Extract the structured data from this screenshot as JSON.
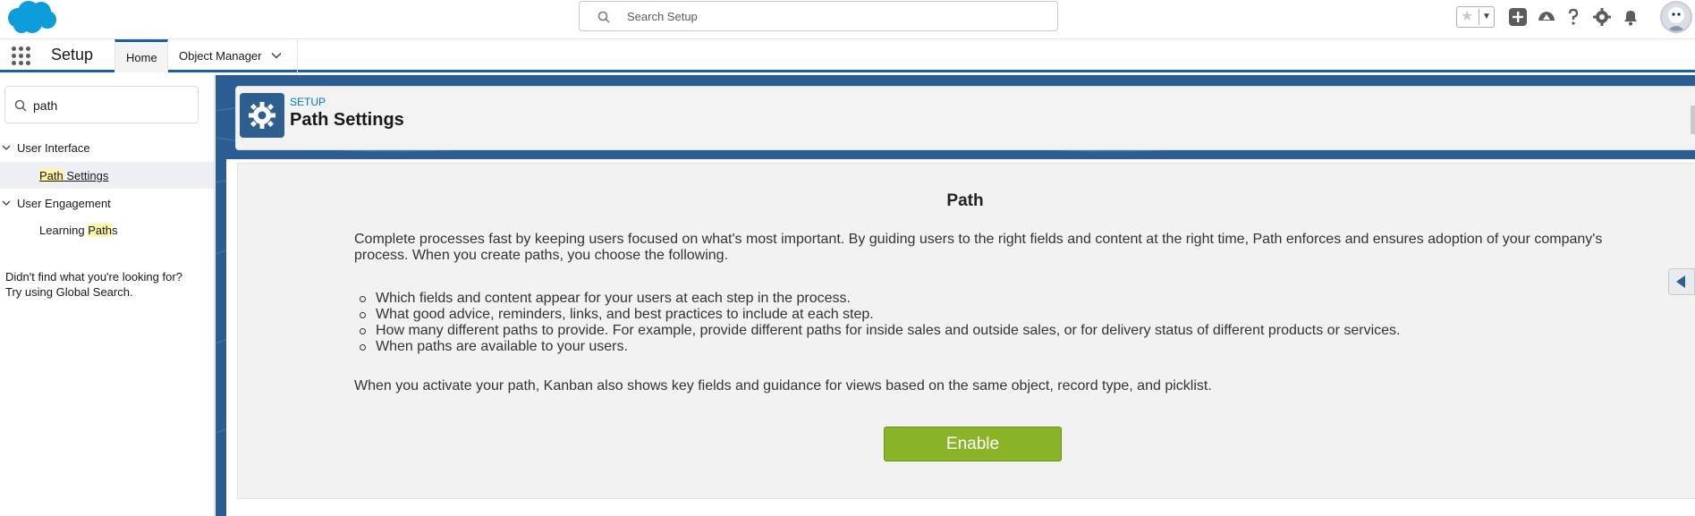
{
  "header": {
    "search_placeholder": "Search Setup",
    "icons": [
      "favorites-star-icon",
      "add-icon",
      "trailhead-icon",
      "help-icon",
      "gear-icon",
      "bell-icon",
      "avatar"
    ]
  },
  "context_bar": {
    "app_name": "Setup",
    "tabs": [
      {
        "label": "Home",
        "active": true
      },
      {
        "label": "Object Manager",
        "active": false
      }
    ]
  },
  "sidebar": {
    "quickfind_value": "path",
    "groups": [
      {
        "label": "User Interface",
        "items": [
          {
            "label_pre": "",
            "label_hl": "Path",
            "label_post": " Settings",
            "active": true
          }
        ]
      },
      {
        "label": "User Engagement",
        "items": [
          {
            "label_pre": "Learning ",
            "label_hl": "Path",
            "label_post": "s",
            "active": false
          }
        ]
      }
    ],
    "notfound_line1": "Didn't find what you're looking for?",
    "notfound_line2": "Try using Global Search."
  },
  "page_header": {
    "eyebrow": "SETUP",
    "title": "Path Settings"
  },
  "content": {
    "title": "Path",
    "intro": "Complete processes fast by keeping users focused on what's most important. By guiding users to the right fields and content at the right time, Path enforces and ensures adoption of your company's process. When you create paths, you choose the following.",
    "bullets": [
      "Which fields and content appear for your users at each step in the process.",
      "What good advice, reminders, links, and best practices to include at each step.",
      "How many different paths to provide. For example, provide different paths for inside sales and outside sales, or for delivery status of different products or services.",
      "When paths are available to your users."
    ],
    "footer": "When you activate your path, Kanban also shows key fields and guidance for views based on the same object, record type, and picklist.",
    "enable_label": "Enable"
  },
  "colors": {
    "brand_blue": "#1b5f9e",
    "enable_green": "#8ab529",
    "highlight": "#fff6a8"
  }
}
